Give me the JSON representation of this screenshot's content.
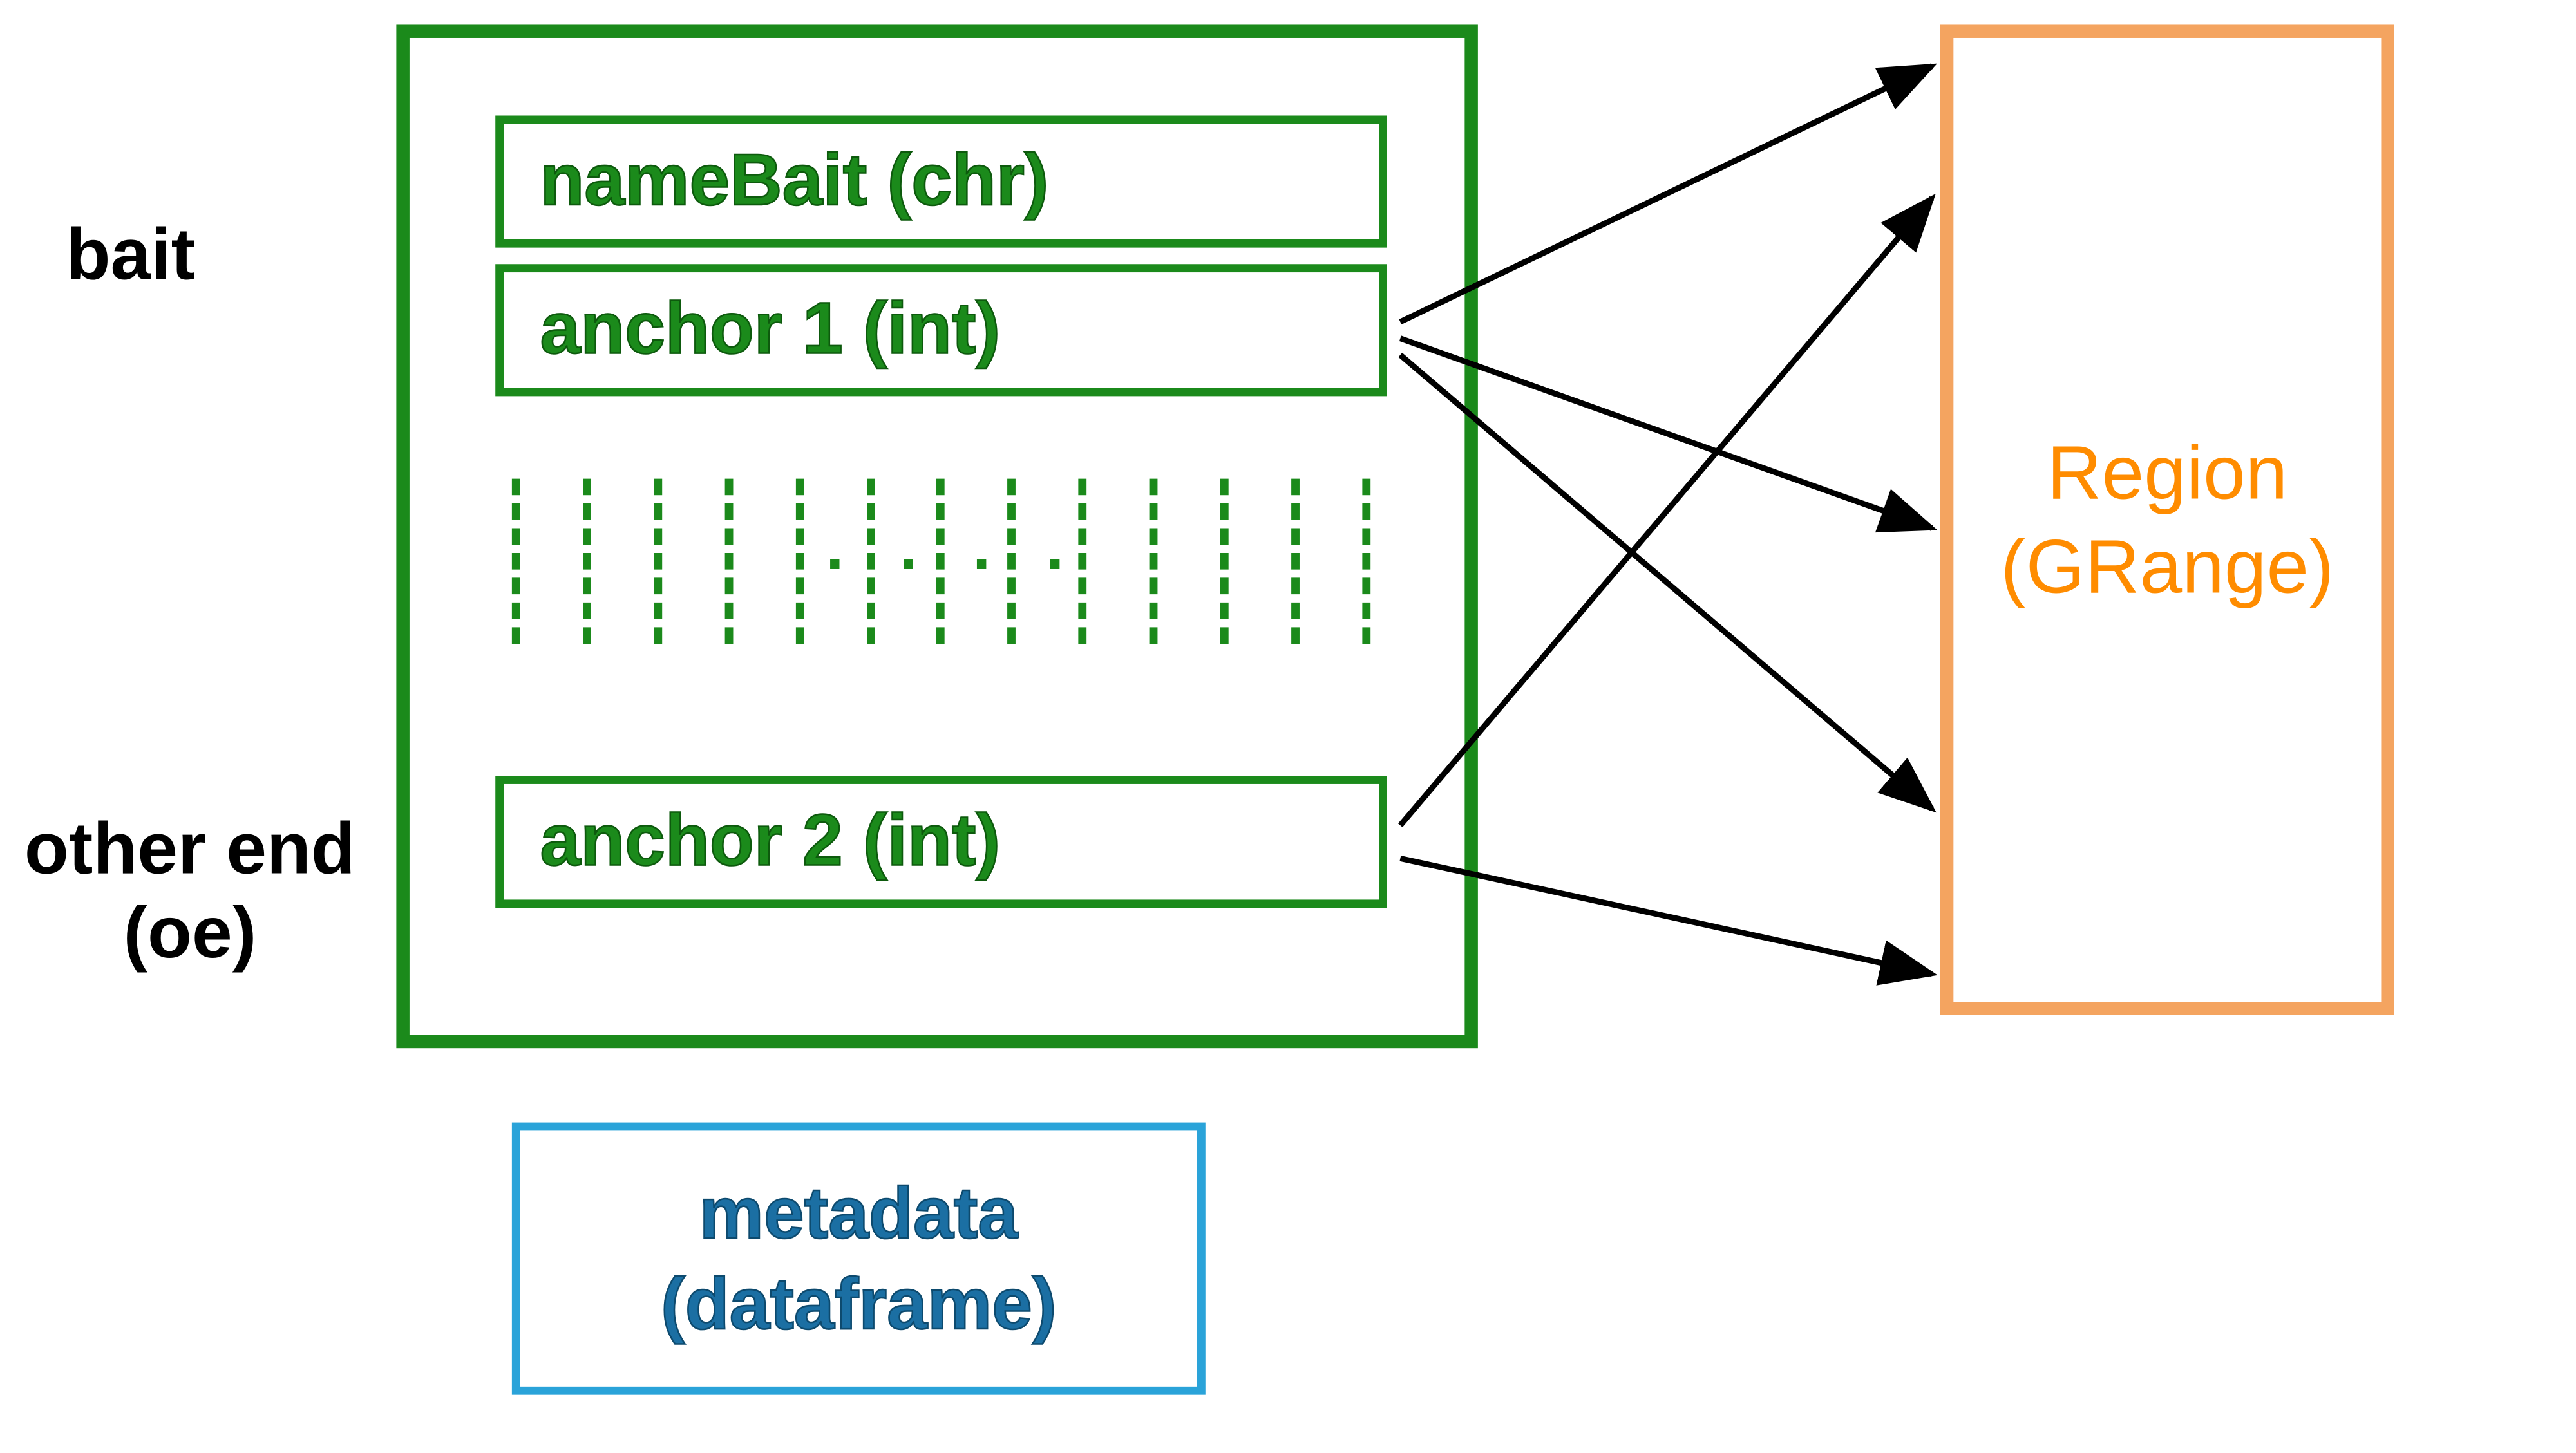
{
  "labels": {
    "bait": "bait",
    "other_end_line1": "other end",
    "other_end_line2": "(oe)"
  },
  "green_box": {
    "name_bait": "nameBait (chr)",
    "anchor1": "anchor 1 (int)",
    "anchor2": "anchor 2 (int)",
    "ellipsis": "· · · ·"
  },
  "region_box": {
    "line1": "Region",
    "line2": "(GRange)"
  },
  "metadata_box": {
    "line1": "metadata",
    "line2": "(dataframe)"
  },
  "colors": {
    "green": "#1b8a1b",
    "orange_border": "#f4a460",
    "orange_text": "#ff8c00",
    "blue_border": "#2aa3d9",
    "blue_text": "#1b6fa3",
    "black": "#000000"
  }
}
